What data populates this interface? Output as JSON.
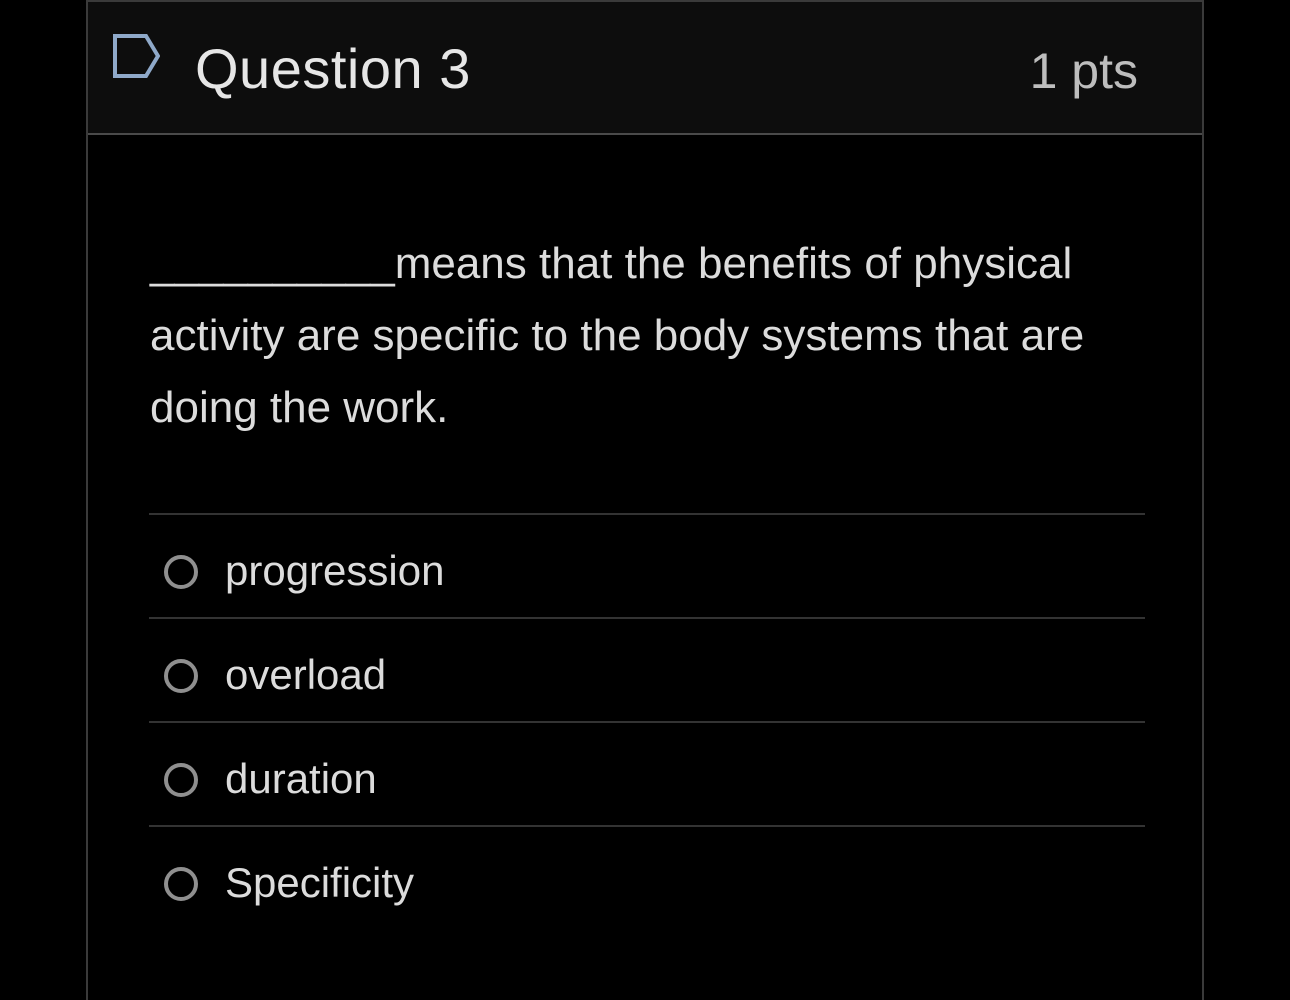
{
  "question": {
    "title": "Question 3",
    "points": "1 pts",
    "flag_icon": "flag-icon",
    "text": "__________means that the benefits of physical activity are specific to the body systems that are doing the work."
  },
  "answers": [
    {
      "label": "progression",
      "selected": false
    },
    {
      "label": "overload",
      "selected": false
    },
    {
      "label": "duration",
      "selected": false
    },
    {
      "label": "Specificity",
      "selected": false
    }
  ],
  "colors": {
    "background": "#000000",
    "header_background": "#0d0d0d",
    "text": "#dcdcdc",
    "radio_border": "#8f8f8f",
    "flag_stroke": "#8fa9c9"
  }
}
